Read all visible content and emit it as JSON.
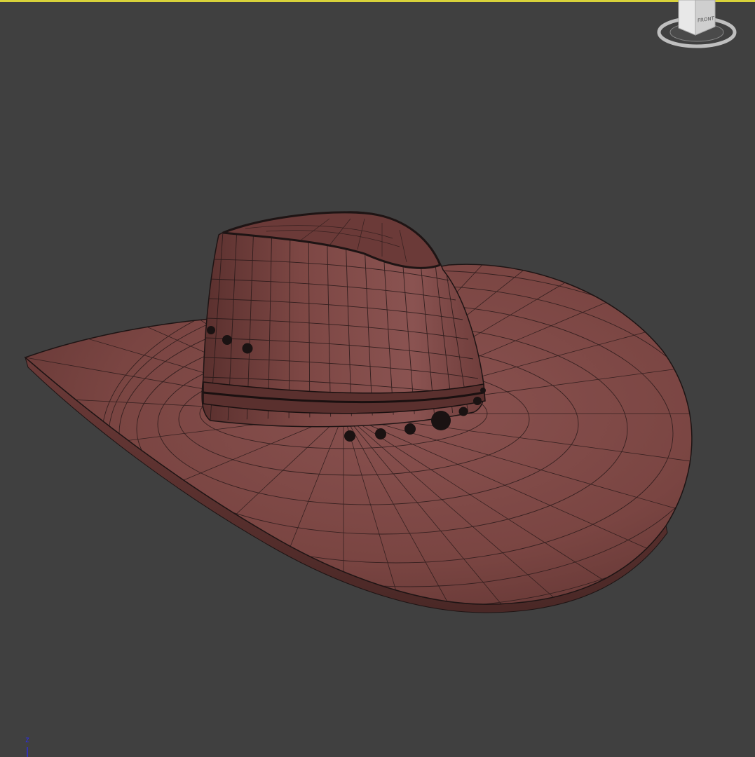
{
  "viewport": {
    "background_color": "#404040",
    "active_border_color": "#d8d23a",
    "model": "cowboy-hat",
    "display_mode": "shaded-with-wireframe",
    "material_color": "#7a4542",
    "wire_color": "#1e1414"
  },
  "viewcube": {
    "face_label": "FRONT",
    "ring_color": "#c8c8c8"
  },
  "axis_tripod": {
    "label": "Z",
    "color": "#2a2aff"
  }
}
